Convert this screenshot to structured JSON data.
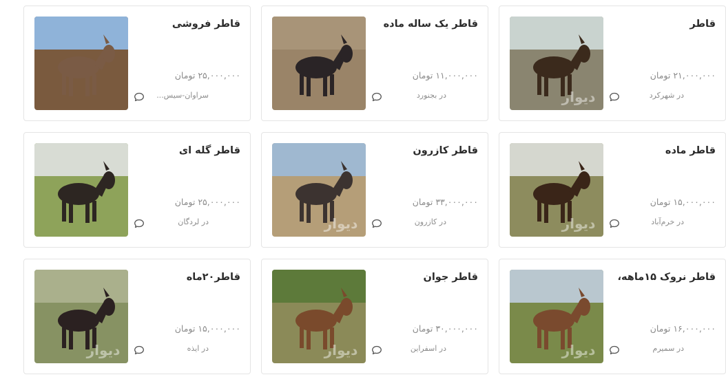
{
  "listings": [
    {
      "title": "قاطر",
      "price": "۲۱,۰۰۰,۰۰۰ تومان",
      "location": "در شهرکرد",
      "watermark": "دیوار",
      "colors": {
        "sky": "#c9d3cf",
        "ground": "#8a8570",
        "animal": "#3b2a1c"
      }
    },
    {
      "title": "قاطر یک ساله ماده",
      "price": "۱۱,۰۰۰,۰۰۰ تومان",
      "location": "در بجنورد",
      "watermark": "",
      "colors": {
        "sky": "#a89478",
        "ground": "#9a8468",
        "animal": "#2a2426"
      }
    },
    {
      "title": "قاطر فروشی",
      "price": "۲۵,۰۰۰,۰۰۰ تومان",
      "location": "سراوان-سیس...",
      "watermark": "",
      "colors": {
        "sky": "#8fb3d9",
        "ground": "#7a5a3e",
        "animal": "#7a5b45"
      }
    },
    {
      "title": "قاطر ماده",
      "price": "۱۵,۰۰۰,۰۰۰ تومان",
      "location": "در خرم‌آباد",
      "watermark": "دیوار",
      "colors": {
        "sky": "#d5d7cf",
        "ground": "#8d8c5e",
        "animal": "#3a2518"
      }
    },
    {
      "title": "قاطر کازرون",
      "price": "۳۳,۰۰۰,۰۰۰ تومان",
      "location": "در کازرون",
      "watermark": "دیوار",
      "colors": {
        "sky": "#9fb8d0",
        "ground": "#b59e78",
        "animal": "#3c3330"
      }
    },
    {
      "title": "قاطر گله ای",
      "price": "۲۵,۰۰۰,۰۰۰ تومان",
      "location": "در لردگان",
      "watermark": "",
      "colors": {
        "sky": "#d8dcd4",
        "ground": "#8ea35a",
        "animal": "#2d2622"
      }
    },
    {
      "title": "قاطر نروک ۱۵ماهه،",
      "price": "۱۶,۰۰۰,۰۰۰ تومان",
      "location": "در سمیرم",
      "watermark": "دیوار",
      "colors": {
        "sky": "#b9c7cf",
        "ground": "#7a8a4a",
        "animal": "#7a4a2e"
      }
    },
    {
      "title": "قاطر جوان",
      "price": "۳۰,۰۰۰,۰۰۰ تومان",
      "location": "در اسفراین",
      "watermark": "دیوار",
      "colors": {
        "sky": "#5d7a3a",
        "ground": "#8b8a58",
        "animal": "#7a4a2c"
      }
    },
    {
      "title": "قاطر۲۰ماه",
      "price": "۱۵,۰۰۰,۰۰۰ تومان",
      "location": "در ایذه",
      "watermark": "دیوار",
      "colors": {
        "sky": "#aab08c",
        "ground": "#879263",
        "animal": "#2b2121"
      }
    }
  ],
  "icons": {
    "chat": "chat-bubble-icon"
  }
}
